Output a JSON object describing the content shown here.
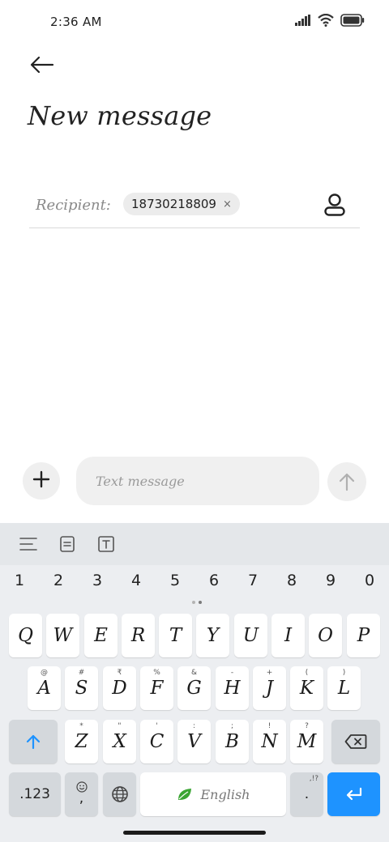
{
  "status_bar": {
    "time": "2:36 AM",
    "icons": [
      "signal-icon",
      "wifi-icon",
      "battery-icon"
    ]
  },
  "header": {
    "back_icon": "back-arrow-icon",
    "title": "New message"
  },
  "recipient": {
    "label": "Recipient:",
    "chips": [
      {
        "value": "18730218809",
        "remove_glyph": "×"
      }
    ],
    "contact_icon": "contact-icon"
  },
  "composer": {
    "attach_glyph": "+",
    "placeholder": "Text message",
    "value": "",
    "send_icon": "send-arrow-icon"
  },
  "keyboard": {
    "toolbar": [
      "menu-lines-icon",
      "clipboard-icon",
      "text-format-icon"
    ],
    "number_row": [
      "1",
      "2",
      "3",
      "4",
      "5",
      "6",
      "7",
      "8",
      "9",
      "0"
    ],
    "row1": [
      "Q",
      "W",
      "E",
      "R",
      "T",
      "Y",
      "U",
      "I",
      "O",
      "P"
    ],
    "row2": [
      {
        "key": "A",
        "hint": "@"
      },
      {
        "key": "S",
        "hint": "#"
      },
      {
        "key": "D",
        "hint": "₹"
      },
      {
        "key": "F",
        "hint": "%"
      },
      {
        "key": "G",
        "hint": "&"
      },
      {
        "key": "H",
        "hint": "-"
      },
      {
        "key": "J",
        "hint": "+"
      },
      {
        "key": "K",
        "hint": "("
      },
      {
        "key": "L",
        "hint": ")"
      }
    ],
    "row3": [
      {
        "key": "Z",
        "hint": "*"
      },
      {
        "key": "X",
        "hint": "\""
      },
      {
        "key": "C",
        "hint": "'"
      },
      {
        "key": "V",
        "hint": ":"
      },
      {
        "key": "B",
        "hint": ";"
      },
      {
        "key": "N",
        "hint": "!"
      },
      {
        "key": "M",
        "hint": "?"
      }
    ],
    "shift_icon": "shift-arrow-icon",
    "backspace_icon": "backspace-icon",
    "bottom": {
      "numbers_label": ".123",
      "comma_label": ",",
      "emoji_icon": "emoji-icon",
      "globe_icon": "globe-icon",
      "space_label": "English",
      "space_icon": "leaf-icon",
      "period_label": ".",
      "period_hint": ",!?",
      "enter_icon": "enter-icon"
    },
    "colors": {
      "enter_key": "#1e93ff",
      "shift_arrow": "#1e93ff",
      "leaf": "#3aa532"
    }
  }
}
